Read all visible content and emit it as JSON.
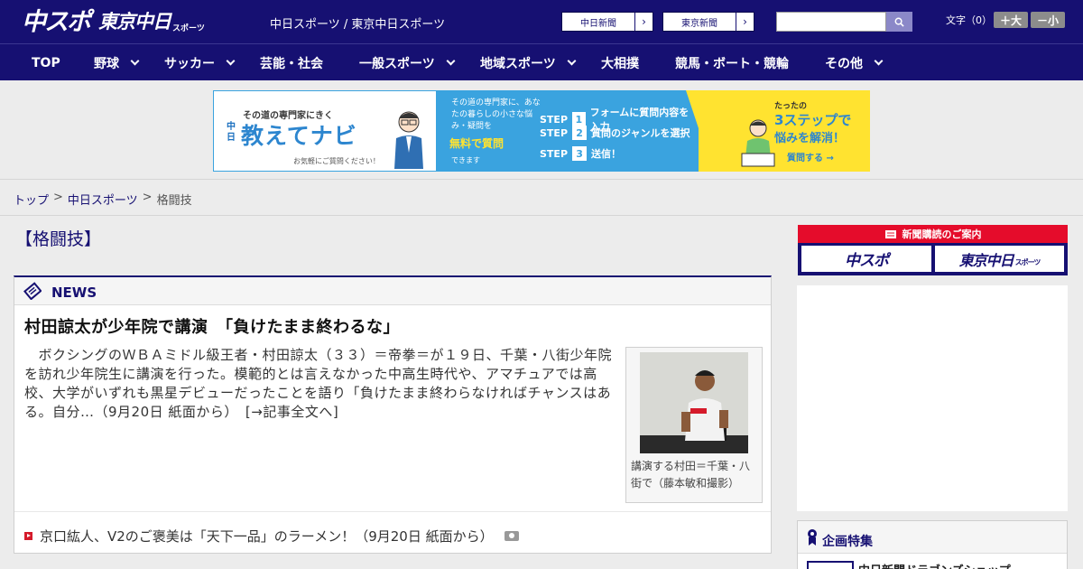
{
  "header": {
    "logo_main": "中スポ",
    "logo_tokyo": "東京中日",
    "logo_tokyo_sub": "スポーツ",
    "site_title": "中日スポーツ / 東京中日スポーツ",
    "link_chunichi": "中日新聞",
    "link_tokyo": "東京新聞",
    "font_label": "文字（0）",
    "font_large": "＋大",
    "font_small": "－小"
  },
  "nav": {
    "items": [
      {
        "label": "TOP",
        "dropdown": false
      },
      {
        "label": "野球",
        "dropdown": true
      },
      {
        "label": "サッカー",
        "dropdown": true
      },
      {
        "label": "芸能・社会",
        "dropdown": false
      },
      {
        "label": "一般スポーツ",
        "dropdown": true
      },
      {
        "label": "地域スポーツ",
        "dropdown": true
      },
      {
        "label": "大相撲",
        "dropdown": false
      },
      {
        "label": "競馬・ボート・競輪",
        "dropdown": false
      },
      {
        "label": "その他",
        "dropdown": true
      }
    ]
  },
  "banner": {
    "tagline": "その道の専門家にきく",
    "brand_small": "中日",
    "brand": "教えてナビ",
    "note": "お気軽にご質問ください！",
    "desc": "その道の専門家に、あなたの暮らしの小さな悩み・疑問を",
    "free": "無料で質問",
    "can": "できます",
    "step_word": "STEP",
    "steps": [
      {
        "num": "1",
        "text": "フォームに質問内容を入力"
      },
      {
        "num": "2",
        "text": "質問のジャンルを選択"
      },
      {
        "num": "3",
        "text": "送信！"
      }
    ],
    "only": "たったの",
    "three_steps": "3ステップで",
    "solve": "悩みを解消！",
    "cta": "質問する →"
  },
  "breadcrumb": {
    "home": "トップ",
    "section": "中日スポーツ",
    "sep": ">",
    "current": "格闘技"
  },
  "main": {
    "heading": "【格闘技】",
    "news_label": "NEWS",
    "article_title": "村田諒太が少年院で講演　「負けたまま終わるな」",
    "article_body": "　ボクシングのＷＢＡミドル級王者・村田諒太（３３）＝帝拳＝が１９日、千葉・八街少年院を訪れ少年院生に講演を行った。模範的とは言えなかった中高生時代や、アマチュアでは高校、大学がいずれも黒星デビューだったことを語り「負けたまま終わらなければチャンスはある。自分…（9月20日 紙面から）　[→記事全文へ]",
    "photo_caption": "講演する村田＝千葉・八街で（藤本敏和撮影）",
    "related": "京口紘人、V2のご褒美は「天下一品」のラーメン！（9月20日 紙面から）"
  },
  "sidebar": {
    "subscribe_title": "新聞購読のご案内",
    "sub_chuspo": "中スポ",
    "sub_tokyo": "東京中日",
    "sub_tokyo_small": "スポーツ",
    "kikaku_title": "企画特集",
    "kikaku_item": "中日新聞ドラゴンズショップ"
  },
  "colors": {
    "brand_navy": "#161072",
    "accent_red": "#e50c2b",
    "banner_blue": "#3aa3df",
    "banner_yellow": "#ffe330"
  }
}
